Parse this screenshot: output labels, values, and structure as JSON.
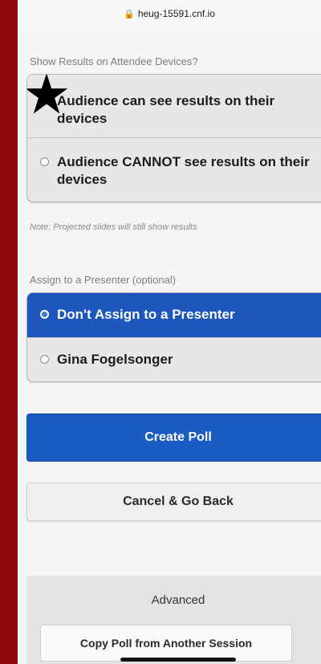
{
  "browser": {
    "url": "heug-15591.cnf.io"
  },
  "results_section": {
    "label": "Show Results on Attendee Devices?",
    "options": [
      {
        "label": "Audience can see results on their devices",
        "selected": false
      },
      {
        "label": "Audience CANNOT see results on their devices",
        "selected": false
      }
    ],
    "annotation_icon": "star-icon",
    "note": "Note: Projected slides will still show results"
  },
  "presenter_section": {
    "label": "Assign to a Presenter (optional)",
    "options": [
      {
        "label": "Don't Assign to a Presenter",
        "selected": true
      },
      {
        "label": "Gina Fogelsonger",
        "selected": false
      }
    ]
  },
  "actions": {
    "create_label": "Create Poll",
    "cancel_label": "Cancel & Go Back"
  },
  "advanced": {
    "title": "Advanced",
    "copy_label": "Copy Poll from Another Session"
  },
  "colors": {
    "frame": "#8e0a0f",
    "primary": "#1a5cc2",
    "selected_option": "#1d56bd"
  }
}
